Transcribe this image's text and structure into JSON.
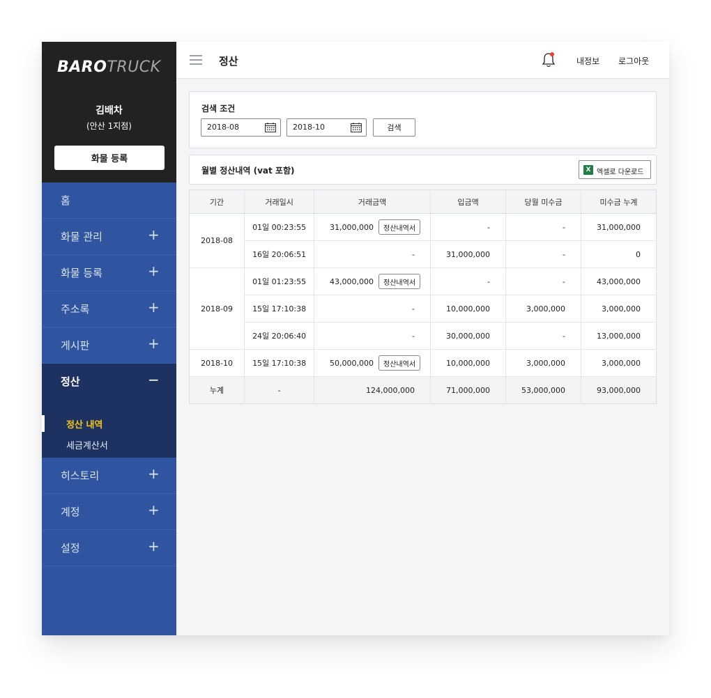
{
  "sidebar": {
    "logo_bold": "BARO",
    "logo_light": "TRUCK",
    "user_name": "김배차",
    "user_branch": "(안산 1지점)",
    "register_button": "화물 등록",
    "menu": [
      {
        "label": "홈",
        "sign": ""
      },
      {
        "label": "화물 관리",
        "sign": "+"
      },
      {
        "label": "화물 등록",
        "sign": "+"
      },
      {
        "label": "주소록",
        "sign": "+"
      },
      {
        "label": "게시판",
        "sign": "+"
      },
      {
        "label": "정산",
        "sign": "−"
      },
      {
        "label": "히스토리",
        "sign": "+"
      },
      {
        "label": "계정",
        "sign": "+"
      },
      {
        "label": "설정",
        "sign": "+"
      }
    ],
    "submenu": [
      "정산 내역",
      "세금계산서"
    ]
  },
  "header": {
    "title": "정산",
    "my_info": "내정보",
    "logout": "로그아웃",
    "notification_color": "#e8412c"
  },
  "search": {
    "label": "검색 조건",
    "start_date": "2018-08",
    "end_date": "2018-10",
    "button": "검색"
  },
  "monthly": {
    "title": "월별 정산내역 (vat 포함)",
    "excel_button": "엑셀로 다운로드",
    "excel_icon_text": "X"
  },
  "table": {
    "headers": [
      "기간",
      "거래일시",
      "거래금액",
      "입금액",
      "당월 미수금",
      "미수금 누계"
    ],
    "statement_button": "정산내역서",
    "rows": [
      {
        "period": "2018-08",
        "datetime": "01일 00:23:55",
        "amount": "31,000,000",
        "deposit": "-",
        "monthly_unpaid": "-",
        "cumulative_unpaid": "31,000,000"
      },
      {
        "period": "",
        "datetime": "16일 20:06:51",
        "amount": "-",
        "deposit": "31,000,000",
        "monthly_unpaid": "-",
        "cumulative_unpaid": "0"
      },
      {
        "period": "2018-09",
        "datetime": "01일 01:23:55",
        "amount": "43,000,000",
        "deposit": "-",
        "monthly_unpaid": "-",
        "cumulative_unpaid": "43,000,000"
      },
      {
        "period": "",
        "datetime": "15일 17:10:38",
        "amount": "-",
        "deposit": "10,000,000",
        "monthly_unpaid": "3,000,000",
        "cumulative_unpaid": "3,000,000"
      },
      {
        "period": "",
        "datetime": "24일 20:06:40",
        "amount": "-",
        "deposit": "30,000,000",
        "monthly_unpaid": "-",
        "cumulative_unpaid": "13,000,000"
      },
      {
        "period": "2018-10",
        "datetime": "15일 17:10:38",
        "amount": "50,000,000",
        "deposit": "10,000,000",
        "monthly_unpaid": "3,000,000",
        "cumulative_unpaid": "3,000,000"
      }
    ],
    "total": {
      "label": "누계",
      "datetime": "-",
      "amount": "124,000,000",
      "deposit": "71,000,000",
      "monthly_unpaid": "53,000,000",
      "cumulative_unpaid": "93,000,000"
    }
  }
}
